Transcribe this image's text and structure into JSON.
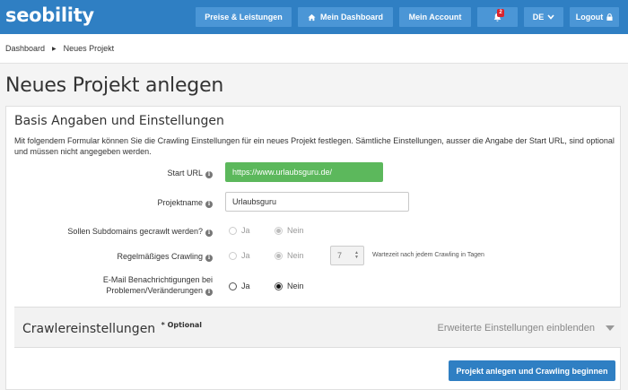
{
  "header": {
    "logo": "seobility",
    "nav": {
      "preise": "Preise & Leistungen",
      "dashboard": "Mein Dashboard",
      "account": "Mein Account",
      "notifications_count": "2",
      "language": "DE",
      "logout": "Logout"
    }
  },
  "breadcrumb": {
    "home": "Dashboard",
    "current": "Neues Projekt"
  },
  "page": {
    "title": "Neues Projekt anlegen"
  },
  "form": {
    "section_title": "Basis Angaben und Einstellungen",
    "description": "Mit folgendem Formular können Sie die Crawling Einstellungen für ein neues Projekt festlegen. Sämtliche Einstellungen, ausser die Angabe der Start URL, sind optional und müssen nicht angegeben werden.",
    "start_url": {
      "label": "Start URL",
      "value": "https://www.urlaubsguru.de/"
    },
    "projektname": {
      "label": "Projektname",
      "value": "Urlaubsguru"
    },
    "subdomains": {
      "label": "Sollen Subdomains gecrawlt werden?",
      "yes": "Ja",
      "no": "Nein",
      "selected": "Nein"
    },
    "regular_crawling": {
      "label": "Regelmäßiges Crawling",
      "yes": "Ja",
      "no": "Nein",
      "selected": "Nein",
      "interval": "7",
      "hint": "Wartezeit nach jedem Crawling in Tagen"
    },
    "email": {
      "label_line1": "E-Mail Benachrichtigungen bei",
      "label_line2": "Problemen/Veränderungen",
      "yes": "Ja",
      "no": "Nein",
      "selected": "Nein"
    }
  },
  "crawler": {
    "title": "Crawlereinstellungen",
    "optional": "* Optional",
    "expand": "Erweiterte Einstellungen einblenden"
  },
  "submit_label": "Projekt anlegen und Crawling beginnen",
  "colors": {
    "primary": "#2f7fc3",
    "nav_button": "#4b96d6",
    "success": "#5cb85c",
    "badge": "#d9232d"
  }
}
